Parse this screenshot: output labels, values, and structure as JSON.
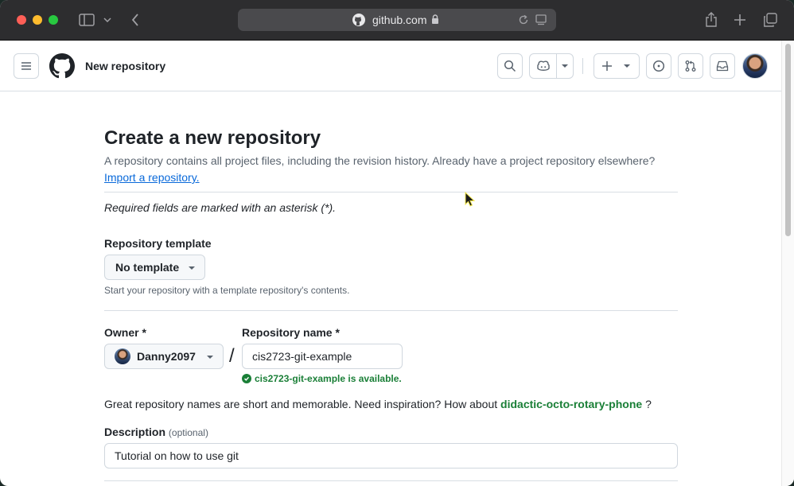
{
  "browser": {
    "url_domain": "github.com"
  },
  "header": {
    "page_title": "New repository"
  },
  "main": {
    "heading": "Create a new repository",
    "intro_text": "A repository contains all project files, including the revision history. Already have a project repository elsewhere?",
    "import_link": "Import a repository.",
    "required_note": "Required fields are marked with an asterisk (*).",
    "template": {
      "label": "Repository template",
      "selected": "No template",
      "note": "Start your repository with a template repository's contents."
    },
    "owner": {
      "label": "Owner *",
      "value": "Danny2097"
    },
    "repo_name": {
      "label": "Repository name *",
      "value": "cis2723-git-example",
      "availability": "cis2723-git-example is available."
    },
    "separator": "/",
    "suggestion": {
      "text": "Great repository names are short and memorable. Need inspiration? How about",
      "name": "didactic-octo-rotary-phone",
      "end": "?"
    },
    "description": {
      "label": "Description",
      "optional": "(optional)",
      "value": "Tutorial on how to use git"
    }
  },
  "colors": {
    "accent_link": "#0969da",
    "success": "#1a7f37",
    "text": "#1f2328"
  }
}
